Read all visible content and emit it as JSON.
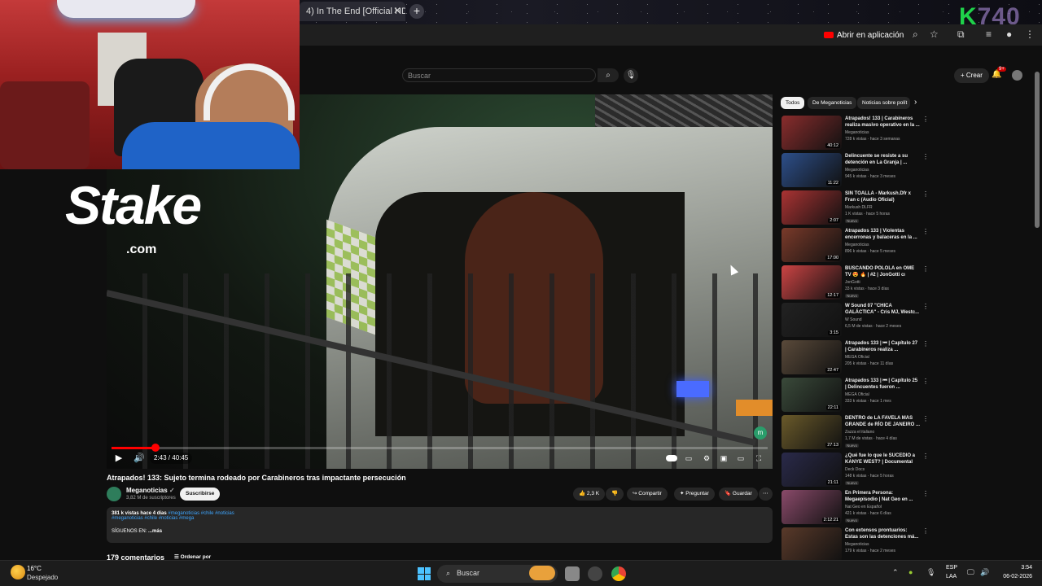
{
  "browser": {
    "tab_title": "4) In The End [Official HD Mu",
    "open_in_app": "Abrir en aplicación",
    "overlay_logo": "K",
    "overlay_logo_rest": "740"
  },
  "youtube": {
    "search_placeholder": "Buscar",
    "create_label": "Crear",
    "notifications_count": "9+"
  },
  "sponsor": {
    "brand": "Stake",
    "tld": ".com"
  },
  "player": {
    "current_time": "2:43",
    "duration": "40:45",
    "time_display": "2:43 / 40:45",
    "progress_fraction": 0.067
  },
  "video": {
    "title": "Atrapados! 133: Sujeto termina rodeado por Carabineros tras impactante persecución",
    "channel": "Meganoticias",
    "subscribers": "3,82 M de suscriptores",
    "subscribe_label": "Suscribirse",
    "likes": "2,3 K",
    "share_label": "Compartir",
    "ask_label": "Preguntar",
    "save_label": "Guardar"
  },
  "description": {
    "stats": "381 k vistas  hace 4 días",
    "tags_line1": "#meganoticias #chile #noticias",
    "tags_line2": "#meganoticias #chile #noticias #mega",
    "follow_text": "SÍGUENOS EN:",
    "more_label": "...más"
  },
  "comments": {
    "count": "179 comentarios",
    "sort_label": "Ordenar por"
  },
  "sidebar": {
    "chips": [
      "Todos",
      "De Meganoticias",
      "Noticias sobre polít"
    ],
    "items": [
      {
        "title": "Atrapados! 133 | Carabineros realiza masivo operativo en la ...",
        "channel": "Meganoticias",
        "meta": "728 k vistas · hace 3 semanas",
        "duration": "40:12",
        "badge": ""
      },
      {
        "title": "Delincuente se resiste a su detención en La Granja | ...",
        "channel": "Meganoticias",
        "meta": "945 k vistas · hace 3 meses",
        "duration": "11:22",
        "badge": ""
      },
      {
        "title": "SIN TOALLA - Markush.Dfr x Fran c (Audio Oficial)",
        "channel": "Markush DLFR",
        "meta": "1 K vistas · hace 5 horas",
        "duration": "2:07",
        "badge": "Nuevo"
      },
      {
        "title": "Atrapados 133 | Violentas encerronas y balaceras en la ...",
        "channel": "Meganoticias",
        "meta": "896 k vistas · hace 5 meses",
        "duration": "17:00",
        "badge": ""
      },
      {
        "title": "BUSCANDO POLOLA en OME TV 😍 🔥 | #2 | JonGotti cı",
        "channel": "JonGotti",
        "meta": "33 k vistas · hace 3 días",
        "duration": "12:17",
        "badge": "Nuevo"
      },
      {
        "title": "W Sound 07 \"CHICA GALÁCTICA\" - Cris MJ, Westc...",
        "channel": "W Sound",
        "meta": "6,5 M de vistas · hace 2 meses",
        "duration": "3:15",
        "badge": ""
      },
      {
        "title": "Atrapados 133 | ⏮ | Capítulo 27 | Carabineros realiza ...",
        "channel": "MEGA Oficial",
        "meta": "205 k vistas · hace 11 días",
        "duration": "22:47",
        "badge": ""
      },
      {
        "title": "Atrapados 133 | ⏮ | Capítulo 25 | Delincuentes fueron ...",
        "channel": "MEGA Oficial",
        "meta": "333 k vistas · hace 1 mes",
        "duration": "22:11",
        "badge": ""
      },
      {
        "title": "DENTRO de LA FAVELA MÁS GRANDE de RÍO DE JANEIRO ...",
        "channel": "Zazza el italiano",
        "meta": "1,7 M de vistas · hace 4 días",
        "duration": "27:13",
        "badge": "Nuevo"
      },
      {
        "title": "¿Qué fue lo que le SUCEDIÓ a KANYE WEST? | Documental",
        "channel": "Deck Docs",
        "meta": "148 k vistas · hace 5 horas",
        "duration": "21:11",
        "badge": "Nuevo"
      },
      {
        "title": "En Primera Persona: Megaepisodio | Nat Geo en ...",
        "channel": "Nat Geo en Español",
        "meta": "421 k vistas · hace 6 días",
        "duration": "2:12:21",
        "badge": "Nuevo"
      },
      {
        "title": "Con extensos prontuarios: Estas son las detenciones má...",
        "channel": "Meganoticias",
        "meta": "179 k vistas · hace 2 meses",
        "duration": "",
        "badge": ""
      }
    ]
  },
  "taskbar": {
    "temperature": "16°C",
    "weather": "Despejado",
    "search_label": "Buscar",
    "lang1": "ESP",
    "lang2": "LAA",
    "time": "3:54",
    "date": "06-02-2026"
  },
  "colors": {
    "accent_red": "#ff0000",
    "link_blue": "#3ea6ff",
    "k740_green": "#1fd14a"
  }
}
